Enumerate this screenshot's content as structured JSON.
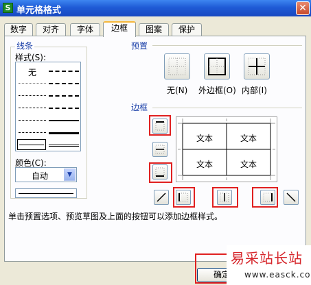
{
  "window": {
    "icon": "S",
    "title": "单元格格式",
    "close": "✕"
  },
  "tabs": [
    {
      "label": "数字"
    },
    {
      "label": "对齐"
    },
    {
      "label": "字体"
    },
    {
      "label": "边框",
      "active": true
    },
    {
      "label": "图案"
    },
    {
      "label": "保护"
    }
  ],
  "line_group": {
    "title": "线条",
    "style_label": "样式(S):",
    "style_none": "无",
    "color_label": "颜色(C):",
    "color_value": "自动"
  },
  "preset_group": {
    "title": "预置",
    "items": [
      {
        "label": "无(N)"
      },
      {
        "label": "外边框(O)"
      },
      {
        "label": "内部(I)"
      }
    ]
  },
  "border_group": {
    "title": "边框"
  },
  "preview_cells": [
    "文本",
    "文本",
    "文本",
    "文本"
  ],
  "hint": "单击预置选项、预览草图及上面的按钮可以添加边框样式。",
  "ok_label": "确定",
  "watermark": {
    "title": "易采站长站",
    "url": "www.easck.com"
  },
  "colors": {
    "titlebar": "#1f5bd6",
    "highlight": "#e02020",
    "group_title": "#1a3fa8",
    "watermark_text": "#d6262b"
  }
}
